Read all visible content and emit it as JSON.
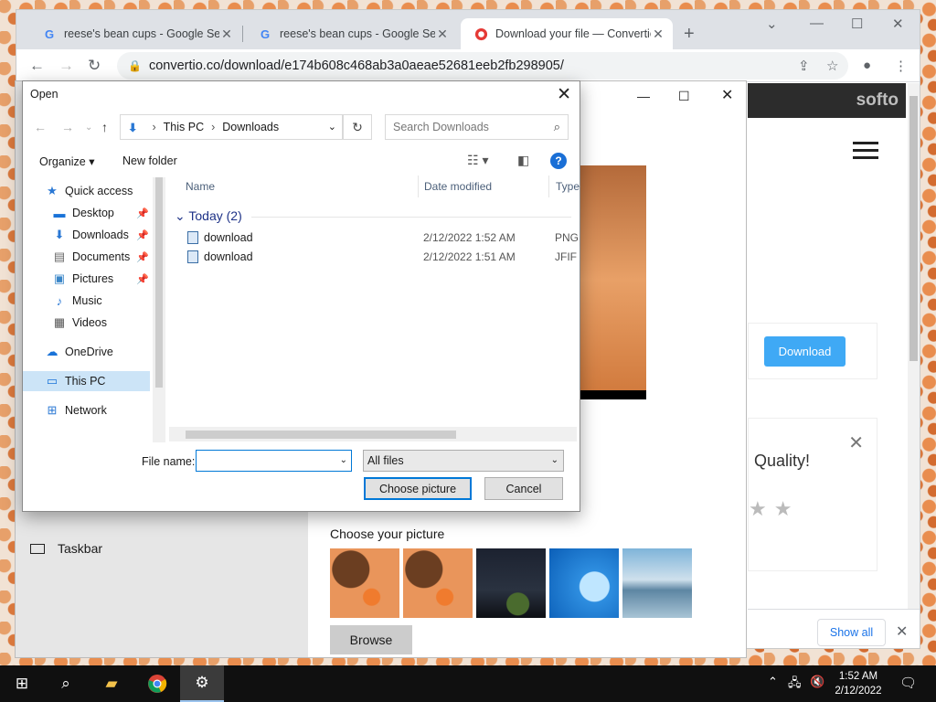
{
  "browser": {
    "tabs": [
      {
        "title": "reese's bean cups - Google Sear",
        "favicon": "G"
      },
      {
        "title": "reese's bean cups - Google Sear",
        "favicon": "G"
      },
      {
        "title": "Download your file — Convertio",
        "favicon": "convertio-icon"
      }
    ],
    "url": "convertio.co/download/e174b608c468ab3a0aeae52681eeb2fb298905/"
  },
  "convertio": {
    "brand": "softo",
    "download_label": "Download",
    "quality_text": "Quality!",
    "show_all_label": "Show all"
  },
  "settings_window": {
    "taskbar_label": "Taskbar",
    "choose_picture_label": "Choose your picture",
    "browse_label": "Browse"
  },
  "dialog": {
    "title": "Open",
    "breadcrumb": [
      "This PC",
      "Downloads"
    ],
    "search_placeholder": "Search Downloads",
    "organize_label": "Organize",
    "new_folder_label": "New folder",
    "nav_items": [
      {
        "label": "Quick access",
        "icon": "star-icon"
      },
      {
        "label": "Desktop",
        "icon": "desktop-icon",
        "pinned": true
      },
      {
        "label": "Downloads",
        "icon": "download-icon",
        "pinned": true
      },
      {
        "label": "Documents",
        "icon": "documents-icon",
        "pinned": true
      },
      {
        "label": "Pictures",
        "icon": "pictures-icon",
        "pinned": true
      },
      {
        "label": "Music",
        "icon": "music-icon"
      },
      {
        "label": "Videos",
        "icon": "videos-icon"
      },
      {
        "label": "OneDrive",
        "icon": "cloud-icon"
      },
      {
        "label": "This PC",
        "icon": "computer-icon",
        "selected": true
      },
      {
        "label": "Network",
        "icon": "network-icon"
      }
    ],
    "columns": [
      "Name",
      "Date modified",
      "Type"
    ],
    "group_label": "Today (2)",
    "files": [
      {
        "name": "download",
        "date": "2/12/2022 1:52 AM",
        "type": "PNG"
      },
      {
        "name": "download",
        "date": "2/12/2022 1:51 AM",
        "type": "JFIF F"
      }
    ],
    "file_name_label": "File name:",
    "file_name_value": "",
    "filter_value": "All files",
    "choose_label": "Choose picture",
    "cancel_label": "Cancel"
  },
  "taskbar": {
    "time": "1:52 AM",
    "date": "2/12/2022"
  }
}
